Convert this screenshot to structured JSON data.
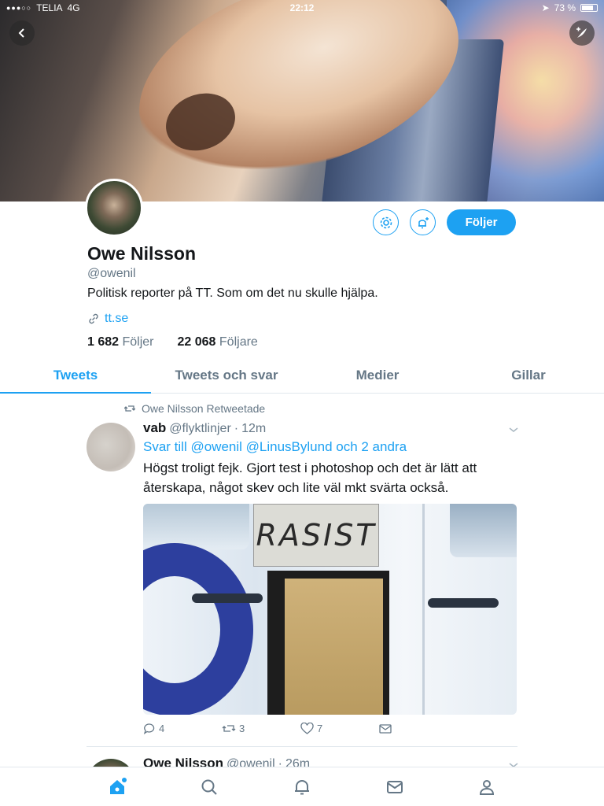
{
  "status_bar": {
    "carrier": "TELIA",
    "network": "4G",
    "time": "22:12",
    "battery": "73 %"
  },
  "profile": {
    "name": "Owe Nilsson",
    "handle": "@owenil",
    "bio": "Politisk reporter på TT. Som om det nu skulle hjälpa.",
    "link": "tt.se",
    "following_count": "1 682",
    "following_label": "Följer",
    "followers_count": "22 068",
    "followers_label": "Följare",
    "follow_button": "Följer"
  },
  "tabs": [
    {
      "label": "Tweets",
      "active": true
    },
    {
      "label": "Tweets och svar",
      "active": false
    },
    {
      "label": "Medier",
      "active": false
    },
    {
      "label": "Gillar",
      "active": false
    }
  ],
  "tweet": {
    "retweet_line": "Owe Nilsson Retweetade",
    "author": "vab",
    "author_handle": "@flyktlinjer",
    "time": "12m",
    "reply_prefix": "Svar till",
    "reply_mentions": "@owenil @LinusBylund och 2 andra",
    "text": "Högst troligt fejk. Gjort test i photoshop och det är lätt att återskapa, något skev och lite väl mkt svärta också.",
    "image_sign_text": "RASIST",
    "replies": "4",
    "retweets": "3",
    "likes": "7"
  },
  "tweet2": {
    "author": "Owe Nilsson",
    "author_handle": "@owenil",
    "time": "26m"
  },
  "colors": {
    "accent": "#1da1f2",
    "muted": "#657786",
    "text": "#14171a"
  }
}
